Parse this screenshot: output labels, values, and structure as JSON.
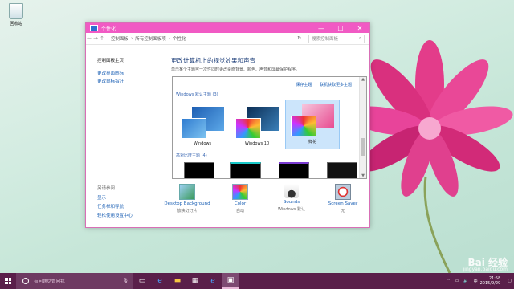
{
  "desktop": {
    "recycle_bin": "回收站"
  },
  "window": {
    "title": "个性化",
    "controls": {
      "minimize": "—",
      "maximize": "☐",
      "close": "✕"
    },
    "address": {
      "back": "←",
      "forward": "→",
      "up": "↑",
      "crumbs": [
        "控制面板",
        "所有控制面板项",
        "个性化"
      ],
      "separator": "›",
      "refresh": "↻",
      "search_placeholder": "搜索控制面板"
    },
    "left_pane": {
      "home": "控制面板主页",
      "change_icons": "更改桌面图标",
      "change_pointer": "更改鼠标指针",
      "see_also": "另请参阅",
      "display": "显示",
      "taskbar": "任务栏和导航",
      "ease": "轻松使用设置中心"
    },
    "main": {
      "heading": "更改计算机上的视觉效果和声音",
      "description": "单击某个主题可一次性同时更改桌面背景、颜色、声音和屏幕保护程序。",
      "save_theme": "保存主题",
      "more_themes": "联机获取更多主题",
      "group_windows": "Windows 默认主题 (3)",
      "group_hc": "高对比度主题 (4)",
      "themes": [
        "Windows",
        "Windows 10",
        "鲜花"
      ],
      "bottom": [
        {
          "name": "Desktop Background",
          "sub": "放映幻灯片"
        },
        {
          "name": "Color",
          "sub": "自动"
        },
        {
          "name": "Sounds",
          "sub": "Windows 默认"
        },
        {
          "name": "Screen Saver",
          "sub": "无"
        }
      ]
    }
  },
  "taskbar": {
    "search_placeholder": "有问题尽管问我",
    "tray_lang": "中",
    "time": "21:58",
    "date": "2015/9/29"
  },
  "watermark": {
    "brand": "Bai 经验",
    "site": "jingyan.baidu.com"
  },
  "colors": {
    "titlebar": "#f15ac4",
    "taskbar": "#5a1f4a",
    "link": "#1a5fb4"
  }
}
